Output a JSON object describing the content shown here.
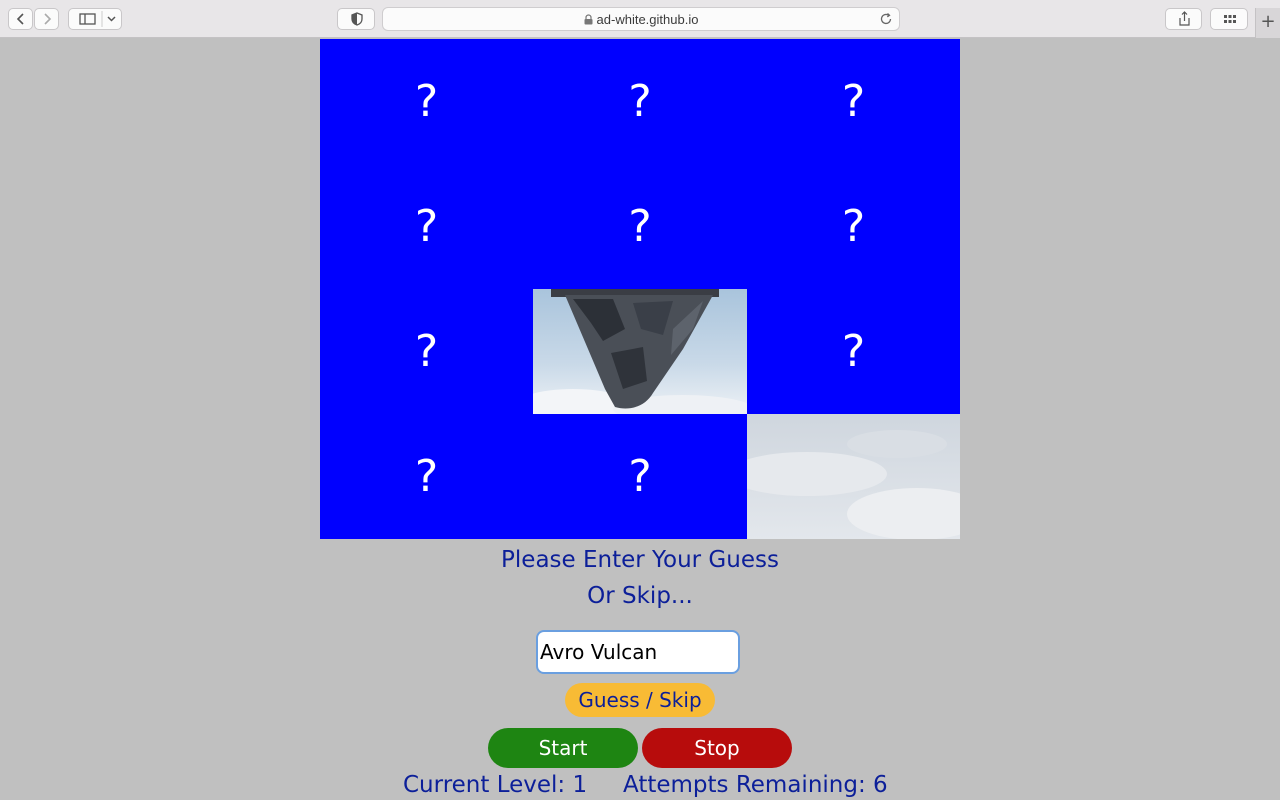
{
  "browser": {
    "url": "ad-white.github.io",
    "new_tab": "+"
  },
  "board": {
    "tiles": [
      {
        "label": "?",
        "revealed": false
      },
      {
        "label": "?",
        "revealed": false
      },
      {
        "label": "?",
        "revealed": false
      },
      {
        "label": "?",
        "revealed": false
      },
      {
        "label": "?",
        "revealed": false
      },
      {
        "label": "?",
        "revealed": false
      },
      {
        "label": "?",
        "revealed": false
      },
      {
        "label": "",
        "revealed": true
      },
      {
        "label": "?",
        "revealed": false
      },
      {
        "label": "?",
        "revealed": false
      },
      {
        "label": "?",
        "revealed": false
      },
      {
        "label": "",
        "revealed": true
      }
    ]
  },
  "game": {
    "prompt_line1": "Please Enter Your Guess",
    "prompt_line2": "Or Skip...",
    "guess_value": "Avro Vulcan",
    "guess_button": "Guess / Skip",
    "start_button": "Start",
    "stop_button": "Stop",
    "current_level": "Current Level: 1",
    "attempts_remaining": "Attempts Remaining: 6"
  },
  "colors": {
    "tile_hidden": "#0000ff",
    "text_accent": "#0c1f99",
    "guess_button": "#f8bb35",
    "start_button": "#1e8512",
    "stop_button": "#b70c0c",
    "page_background": "#c0c0c0"
  }
}
